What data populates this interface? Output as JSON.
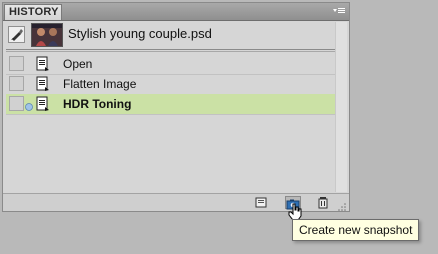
{
  "panel": {
    "tab_label": "HISTORY",
    "menu_icon": "panel-menu-icon"
  },
  "snapshot": {
    "label": "Stylish young couple.psd",
    "brush_icon": "history-brush-icon"
  },
  "history_items": [
    {
      "label": "Open",
      "selected": false
    },
    {
      "label": "Flatten Image",
      "selected": false
    },
    {
      "label": "HDR Toning",
      "selected": true
    }
  ],
  "bottom_bar": {
    "new_document_icon": "new-document-from-state-icon",
    "snapshot_icon": "camera-icon",
    "delete_icon": "trash-icon"
  },
  "tooltip": {
    "text": "Create new snapshot"
  },
  "colors": {
    "selected_row": "#cbe1a5",
    "panel_bg": "#d6d6d6",
    "tooltip_bg": "#ffffe1"
  }
}
